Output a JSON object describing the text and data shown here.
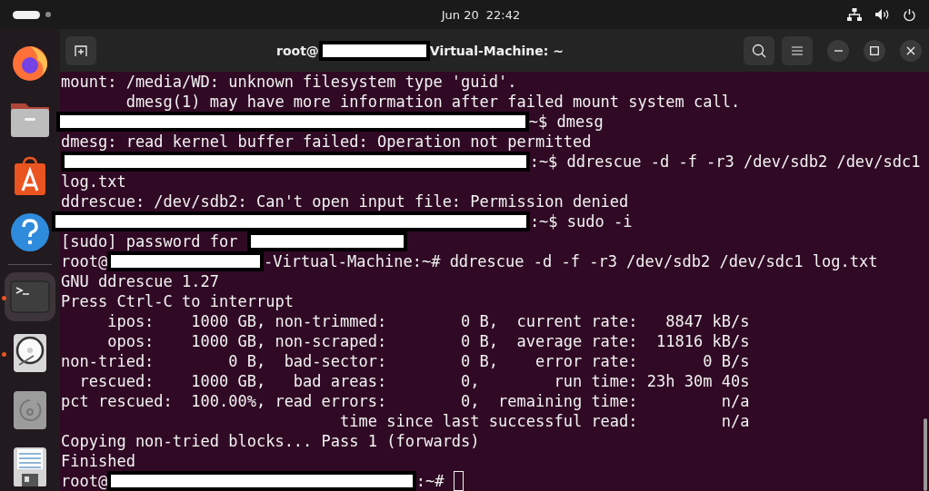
{
  "top_bar": {
    "date": "Jun 20",
    "time": "22:42"
  },
  "dock": [
    {
      "kind": "firefox",
      "running": false,
      "selected": false
    },
    {
      "kind": "folder",
      "running": false,
      "selected": false
    },
    {
      "kind": "store",
      "running": false,
      "selected": false
    },
    {
      "kind": "help",
      "running": false,
      "selected": false
    },
    {
      "kind": "separator"
    },
    {
      "kind": "terminal",
      "running": true,
      "selected": true
    },
    {
      "kind": "disk",
      "running": true,
      "selected": false
    },
    {
      "kind": "disc",
      "running": false,
      "selected": false
    },
    {
      "kind": "editor",
      "running": false,
      "selected": false
    }
  ],
  "window": {
    "title": [
      {
        "kind": "text",
        "text": "root@"
      },
      {
        "kind": "redacted"
      },
      {
        "kind": "text",
        "text": "Virtual-Machine: ~"
      }
    ]
  },
  "terminal_lines": [
    [
      {
        "kind": "text",
        "text": "mount: /media/WD: unknown filesystem type 'guid'."
      }
    ],
    [
      {
        "kind": "text",
        "text": "       dmesg(1) may have more information after failed mount system call."
      }
    ],
    [
      {
        "kind": "redacted"
      },
      {
        "kind": "text",
        "text": "~$ dmesg"
      }
    ],
    [
      {
        "kind": "text",
        "text": "dmesg: read kernel buffer failed: Operation not permitted"
      }
    ],
    [
      {
        "kind": "redacted"
      },
      {
        "kind": "text",
        "text": ":~$ ddrescue -d -f -r3 /dev/sdb2 /dev/sdc1"
      }
    ],
    [
      {
        "kind": "text",
        "text": "log.txt"
      }
    ],
    [
      {
        "kind": "text",
        "text": "ddrescue: /dev/sdb2: Can't open input file: Permission denied"
      }
    ],
    [
      {
        "kind": "redacted"
      },
      {
        "kind": "text",
        "text": ":~$ sudo -i"
      }
    ],
    [
      {
        "kind": "text",
        "text": "[sudo] password for "
      },
      {
        "kind": "redacted"
      }
    ],
    [
      {
        "kind": "text",
        "text": "root@"
      },
      {
        "kind": "redacted"
      },
      {
        "kind": "text",
        "text": "-Virtual-Machine:~# ddrescue -d -f -r3 /dev/sdb2 /dev/sdc1 log.txt"
      }
    ],
    [
      {
        "kind": "text",
        "text": "GNU ddrescue 1.27"
      }
    ],
    [
      {
        "kind": "text",
        "text": "Press Ctrl-C to interrupt"
      }
    ],
    [
      {
        "kind": "text",
        "text": "     ipos:    1000 GB, non-trimmed:        0 B,  current rate:   8847 kB/s"
      }
    ],
    [
      {
        "kind": "text",
        "text": "     opos:    1000 GB, non-scraped:        0 B,  average rate:  11816 kB/s"
      }
    ],
    [
      {
        "kind": "text",
        "text": "non-tried:        0 B,  bad-sector:        0 B,    error rate:       0 B/s"
      }
    ],
    [
      {
        "kind": "text",
        "text": "  rescued:    1000 GB,   bad areas:        0,        run time: 23h 30m 40s"
      }
    ],
    [
      {
        "kind": "text",
        "text": "pct rescued:  100.00%, read errors:        0,  remaining time:         n/a"
      }
    ],
    [
      {
        "kind": "text",
        "text": "                              time since last successful read:         n/a"
      }
    ],
    [
      {
        "kind": "text",
        "text": "Copying non-tried blocks... Pass 1 (forwards)"
      }
    ],
    [
      {
        "kind": "text",
        "text": "Finished"
      }
    ],
    [
      {
        "kind": "text",
        "text": "root@"
      },
      {
        "kind": "redacted"
      },
      {
        "kind": "text",
        "text": ":~# "
      },
      {
        "kind": "cursor"
      }
    ]
  ]
}
